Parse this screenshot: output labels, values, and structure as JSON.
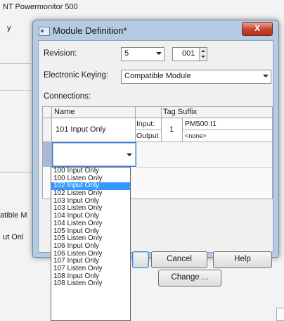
{
  "background": {
    "window_title": "NT Powermonitor 500",
    "fragment_y": "y",
    "fragment_compatible": "atible M",
    "fragment_input": "ut Onl",
    "change_button": "Change ..."
  },
  "dialog": {
    "title": "Module Definition*",
    "close_label": "X",
    "revision_label": "Revision:",
    "revision_major": "5",
    "revision_minor": "001",
    "keying_label": "Electronic Keying:",
    "keying_value": "Compatible Module",
    "connections_label": "Connections:",
    "grid": {
      "headers": {
        "name": "Name",
        "tag_suffix": "Tag Suffix"
      },
      "row": {
        "name": "101 Input Only",
        "input_label": "Input:",
        "output_label": "Output",
        "rpi": "1",
        "input_tag": "PM500:I1",
        "output_tag": "<none>"
      }
    },
    "buttons": {
      "ok": "",
      "cancel": "Cancel",
      "help": "Help"
    }
  },
  "dropdown": {
    "selected": "102 Input Only",
    "options": [
      "100 Input Only",
      "100 Listen Only",
      "102 Input Only",
      "102 Listen Only",
      "103 Input Only",
      "103 Listen Only",
      "104 Input Only",
      "104 Listen Only",
      "105 Input Only",
      "105 Listen Only",
      "106 Input Only",
      "106 Listen Only",
      "107 Input Only",
      "107 Listen Only",
      "108 Input Only",
      "108 Listen Only"
    ]
  },
  "colors": {
    "dialog_frame": "#b5cbe3",
    "close_button": "#c6432c",
    "selection": "#3399ff"
  }
}
